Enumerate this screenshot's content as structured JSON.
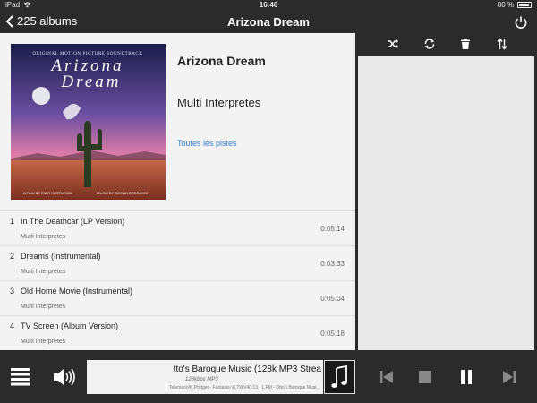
{
  "status_bar": {
    "device": "iPad",
    "time": "16:46",
    "battery_text": "80 %",
    "battery_level": 0.8
  },
  "nav": {
    "back_label": "225 albums",
    "title": "Arizona Dream"
  },
  "album": {
    "title": "Arizona Dream",
    "artist": "Multi Interpretes",
    "all_tracks_link": "Toutes les pistes",
    "cover": {
      "top_text": "ORIGINAL MOTION PICTURE SOUNDTRACK",
      "title_line1": "Arizona",
      "title_line2": "Dream",
      "bottom_left": "A FILM BY EMIR KUSTURICA",
      "bottom_right": "MUSIC BY GORAN BREGOVIC"
    }
  },
  "tracks": [
    {
      "num": "1",
      "title": "In The Deathcar (LP Version)",
      "artist": "Multi Interpretes",
      "duration": "0:05:14"
    },
    {
      "num": "2",
      "title": "Dreams (Instrumental)",
      "artist": "Multi Interpretes",
      "duration": "0:03:33"
    },
    {
      "num": "3",
      "title": "Old Home Movie (Instrumental)",
      "artist": "Multi Interpretes",
      "duration": "0:05:04"
    },
    {
      "num": "4",
      "title": "TV Screen (Album Version)",
      "artist": "Multi Interpretes",
      "duration": "0:05:18"
    }
  ],
  "queue_toolbar": {
    "icons": [
      "shuffle-icon",
      "repeat-icon",
      "trash-icon",
      "sort-icon"
    ]
  },
  "player": {
    "now_playing_title": "tto's Baroque Music (128k MP3 Strea",
    "now_playing_format": "128kbps MP3",
    "now_playing_desc": "Telemann/K.Pfrdger - Fantasia VI,TWV40:13 - 1,FM - Otto's Baroque Musi..."
  },
  "colors": {
    "bar": "#2b2b2b",
    "panel": "#f3f3f3",
    "queue": "#e9e9e9",
    "link": "#2b7cd3"
  }
}
